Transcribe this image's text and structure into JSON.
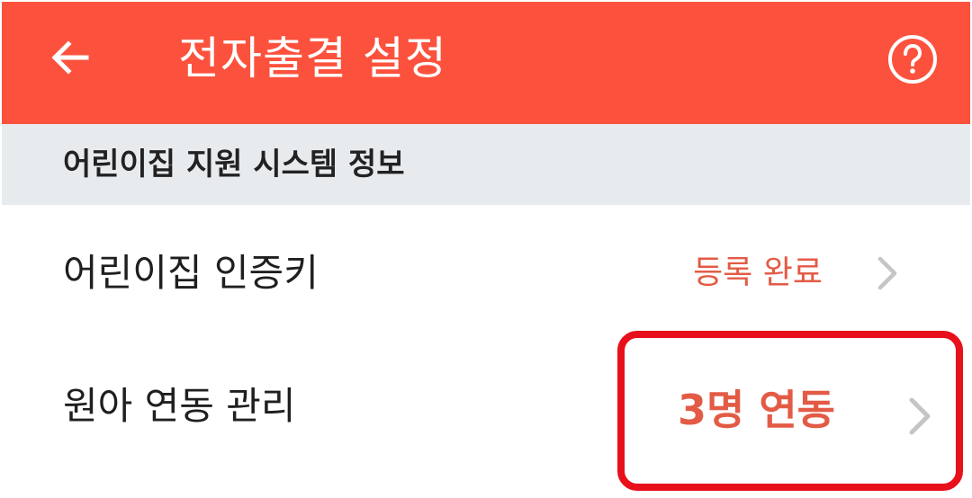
{
  "header": {
    "title": "전자출결 설정",
    "back_icon": "arrow-left-icon",
    "help_icon": "question-circle-icon",
    "background_color": "#fc523d"
  },
  "section": {
    "title": "어린이집 지원 시스템 정보"
  },
  "settings": [
    {
      "label": "어린이집 인증키",
      "value": "등록 완료",
      "icon": "chevron-right-icon"
    },
    {
      "label": "원아 연동 관리",
      "value": "3명 연동",
      "icon": "chevron-right-icon"
    }
  ],
  "colors": {
    "value_text": "#e35b45",
    "highlight": "#e8101a",
    "section_background": "#e8ebee"
  }
}
